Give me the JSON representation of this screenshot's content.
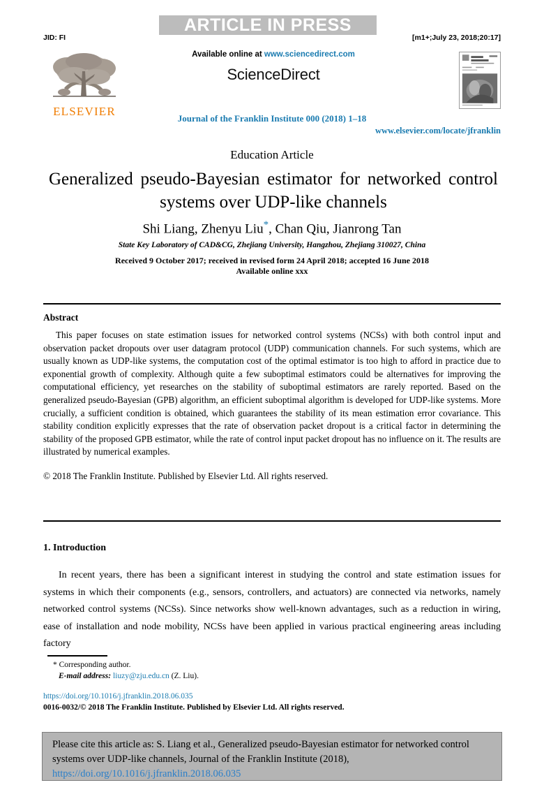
{
  "banner": {
    "text": "ARTICLE IN PRESS",
    "background_color": "#bcbcbc",
    "text_color": "#ffffff"
  },
  "header": {
    "jid": "JID: FI",
    "version_stamp": "[m1+;July 23, 2018;20:17]"
  },
  "masthead": {
    "available_online_prefix": "Available online at ",
    "sciencedirect_url": "www.sciencedirect.com",
    "sciencedirect_wordmark": "ScienceDirect",
    "publisher_name": "ELSEVIER",
    "publisher_color": "#f07c00",
    "link_color": "#1a7bb0"
  },
  "journal": {
    "reference_line": "Journal of the Franklin Institute 000 (2018) 1–18",
    "locate_url": "www.elsevier.com/locate/jfranklin"
  },
  "article": {
    "type": "Education Article",
    "title": "Generalized pseudo-Bayesian estimator for networked control systems over UDP-like channels",
    "authors": "Shi Liang, Zhenyu Liu",
    "authors_suffix": ", Chan Qiu, Jianrong Tan",
    "corresponding_marker": "*",
    "affiliation": "State Key Laboratory of CAD&CG, Zhejiang University, Hangzhou, Zhejiang 310027, China",
    "received_line": "Received 9 October 2017; received in revised form 24 April 2018; accepted 16 June 2018",
    "available_online_line": "Available online xxx"
  },
  "abstract": {
    "heading": "Abstract",
    "body": "This paper focuses on state estimation issues for networked control systems (NCSs) with both control input and observation packet dropouts over user datagram protocol (UDP) communication channels. For such systems, which are usually known as UDP-like systems, the computation cost of the optimal estimator is too high to afford in practice due to exponential growth of complexity. Although quite a few suboptimal estimators could be alternatives for improving the computational efficiency, yet researches on the stability of suboptimal estimators are rarely reported. Based on the generalized pseudo-Bayesian (GPB) algorithm, an efficient suboptimal algorithm is developed for UDP-like systems. More crucially, a sufficient condition is obtained, which guarantees the stability of its mean estimation error covariance. This stability condition explicitly expresses that the rate of observation packet dropout is a critical factor in determining the stability of the proposed GPB estimator, while the rate of control input packet dropout has no influence on it. The results are illustrated by numerical examples.",
    "copyright": "© 2018 The Franklin Institute. Published by Elsevier Ltd. All rights reserved."
  },
  "introduction": {
    "heading": "1. Introduction",
    "body": "In recent years, there has been a significant interest in studying the control and state estimation issues for systems in which their components (e.g., sensors, controllers, and actuators) are connected via networks, namely networked control systems (NCSs). Since networks show well-known advantages, such as a reduction in wiring, ease of installation and node mobility, NCSs have been applied in various practical engineering areas including factory"
  },
  "footnote": {
    "corresponding_author": "* Corresponding author.",
    "email_label": "E-mail address:",
    "email_address": "liuzy@zju.edu.cn",
    "email_attribution": "(Z. Liu).",
    "doi": "https://doi.org/10.1016/j.jfranklin.2018.06.035",
    "issn_line": "0016-0032/© 2018 The Franklin Institute. Published by Elsevier Ltd. All rights reserved."
  },
  "citation_box": {
    "text": "Please cite this article as: S. Liang et al., Generalized pseudo-Bayesian estimator for networked control systems over UDP-like channels, Journal of the Franklin Institute (2018),",
    "doi": "https://doi.org/10.1016/j.jfranklin.2018.06.035",
    "background_color": "#b4b4b4",
    "doi_color": "#2a7fc9"
  }
}
